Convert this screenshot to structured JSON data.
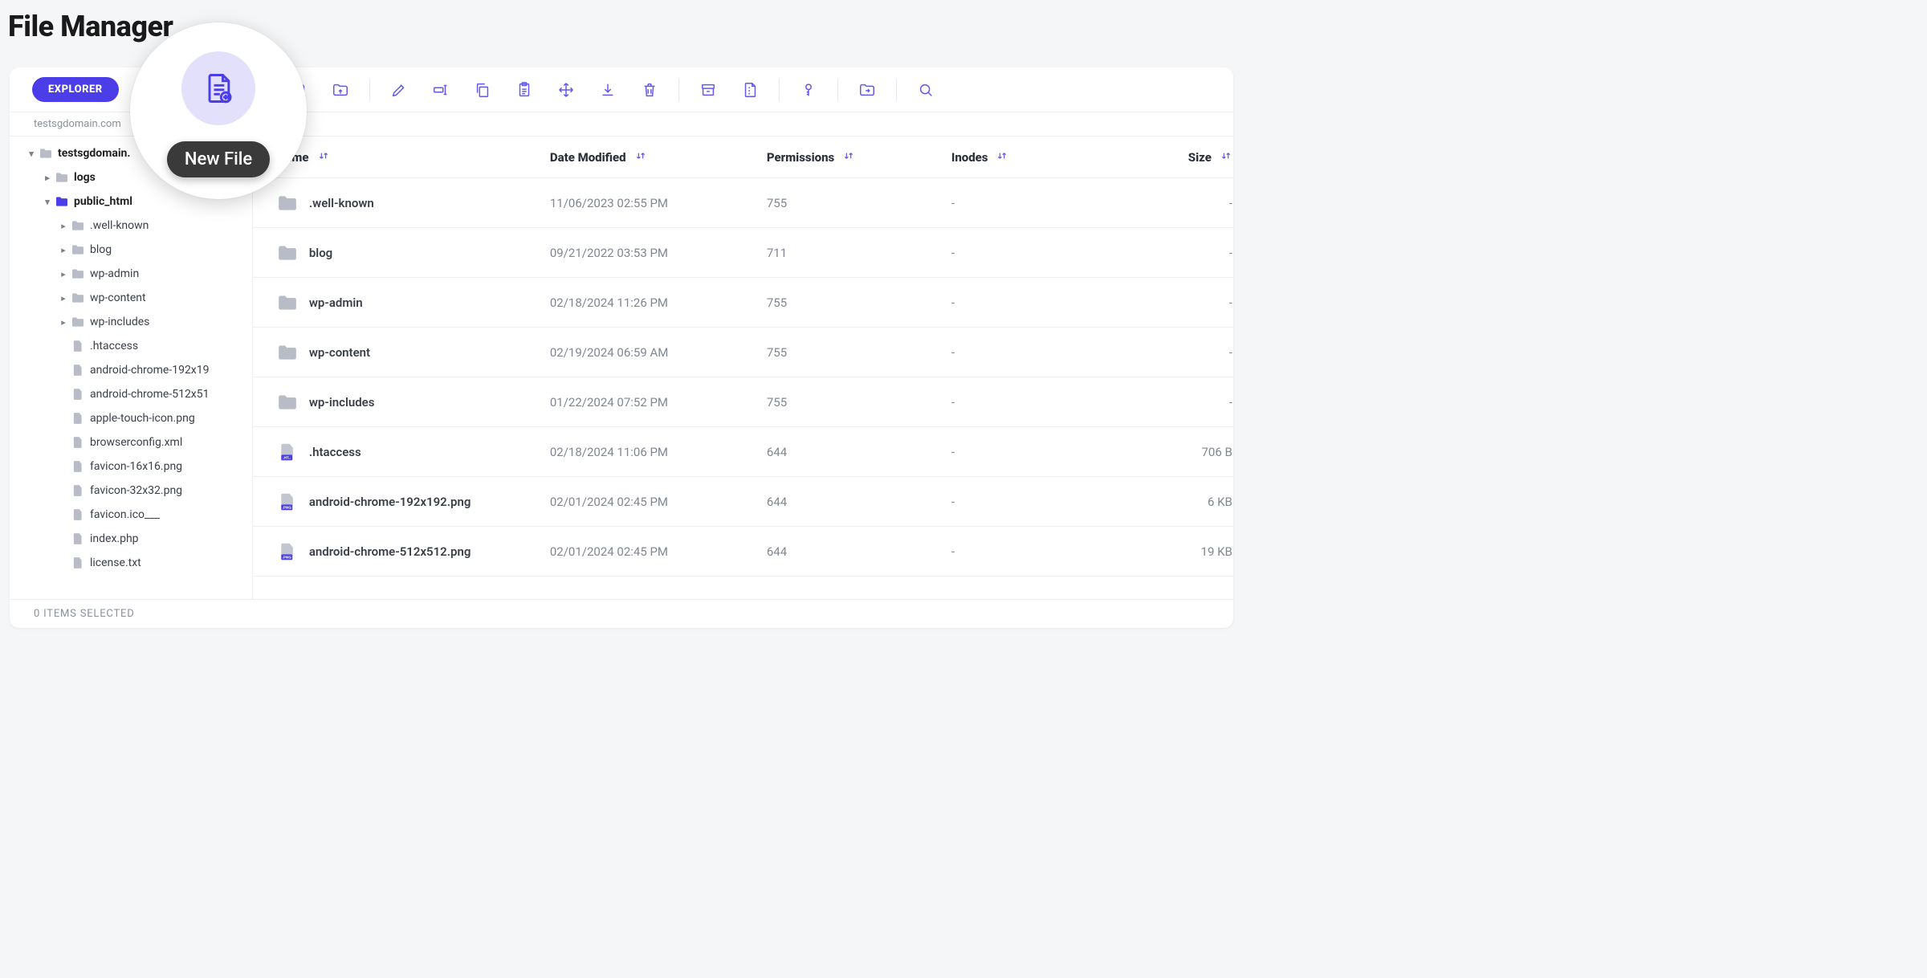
{
  "pageTitle": "File Manager",
  "tabs": {
    "explorer": "EXPLORER"
  },
  "breadcrumb": "testsgdomain.com",
  "magnifier": {
    "tooltip": "New File"
  },
  "toolbarIcons": [
    "new-file-icon",
    "new-folder-icon",
    "upload-file-icon",
    "upload-folder-icon",
    "edit-icon",
    "rename-icon",
    "copy-icon",
    "paste-icon",
    "move-icon",
    "download-icon",
    "delete-icon",
    "archive-icon",
    "extract-icon",
    "permissions-icon",
    "open-location-icon",
    "search-icon"
  ],
  "tree": [
    {
      "depth": 0,
      "caret": "down",
      "icon": "folder-grey",
      "label": "testsgdomain.",
      "bold": true
    },
    {
      "depth": 1,
      "caret": "right",
      "icon": "folder-grey",
      "label": "logs",
      "bold": true
    },
    {
      "depth": 1,
      "caret": "down",
      "icon": "folder-blue",
      "label": "public_html",
      "bold": true
    },
    {
      "depth": 2,
      "caret": "right",
      "icon": "folder-grey",
      "label": ".well-known"
    },
    {
      "depth": 2,
      "caret": "right",
      "icon": "folder-grey",
      "label": "blog"
    },
    {
      "depth": 2,
      "caret": "right",
      "icon": "folder-grey",
      "label": "wp-admin"
    },
    {
      "depth": 2,
      "caret": "right",
      "icon": "folder-grey",
      "label": "wp-content"
    },
    {
      "depth": 2,
      "caret": "right",
      "icon": "folder-grey",
      "label": "wp-includes"
    },
    {
      "depth": 2,
      "caret": "",
      "icon": "file-grey",
      "label": ".htaccess"
    },
    {
      "depth": 2,
      "caret": "",
      "icon": "file-grey",
      "label": "android-chrome-192x19"
    },
    {
      "depth": 2,
      "caret": "",
      "icon": "file-grey",
      "label": "android-chrome-512x51"
    },
    {
      "depth": 2,
      "caret": "",
      "icon": "file-grey",
      "label": "apple-touch-icon.png"
    },
    {
      "depth": 2,
      "caret": "",
      "icon": "file-grey",
      "label": "browserconfig.xml"
    },
    {
      "depth": 2,
      "caret": "",
      "icon": "file-grey",
      "label": "favicon-16x16.png"
    },
    {
      "depth": 2,
      "caret": "",
      "icon": "file-grey",
      "label": "favicon-32x32.png"
    },
    {
      "depth": 2,
      "caret": "",
      "icon": "file-grey",
      "label": "favicon.ico___"
    },
    {
      "depth": 2,
      "caret": "",
      "icon": "file-grey",
      "label": "index.php"
    },
    {
      "depth": 2,
      "caret": "",
      "icon": "file-grey",
      "label": "license.txt"
    }
  ],
  "columns": {
    "name": "Name",
    "date": "Date Modified",
    "perm": "Permissions",
    "inodes": "Inodes",
    "size": "Size"
  },
  "rows": [
    {
      "type": "folder",
      "name": ".well-known",
      "date": "11/06/2023 02:55 PM",
      "perm": "755",
      "inodes": "-",
      "size": "-"
    },
    {
      "type": "folder",
      "name": "blog",
      "date": "09/21/2022 03:53 PM",
      "perm": "711",
      "inodes": "-",
      "size": "-"
    },
    {
      "type": "folder",
      "name": "wp-admin",
      "date": "02/18/2024 11:26 PM",
      "perm": "755",
      "inodes": "-",
      "size": "-"
    },
    {
      "type": "folder",
      "name": "wp-content",
      "date": "02/19/2024 06:59 AM",
      "perm": "755",
      "inodes": "-",
      "size": "-"
    },
    {
      "type": "folder",
      "name": "wp-includes",
      "date": "01/22/2024 07:52 PM",
      "perm": "755",
      "inodes": "-",
      "size": "-"
    },
    {
      "type": "ht",
      "name": ".htaccess",
      "date": "02/18/2024 11:06 PM",
      "perm": "644",
      "inodes": "-",
      "size": "706 B"
    },
    {
      "type": "png",
      "name": "android-chrome-192x192.png",
      "date": "02/01/2024 02:45 PM",
      "perm": "644",
      "inodes": "-",
      "size": "6 KB"
    },
    {
      "type": "png",
      "name": "android-chrome-512x512.png",
      "date": "02/01/2024 02:45 PM",
      "perm": "644",
      "inodes": "-",
      "size": "19 KB"
    }
  ],
  "status": "0 ITEMS SELECTED"
}
